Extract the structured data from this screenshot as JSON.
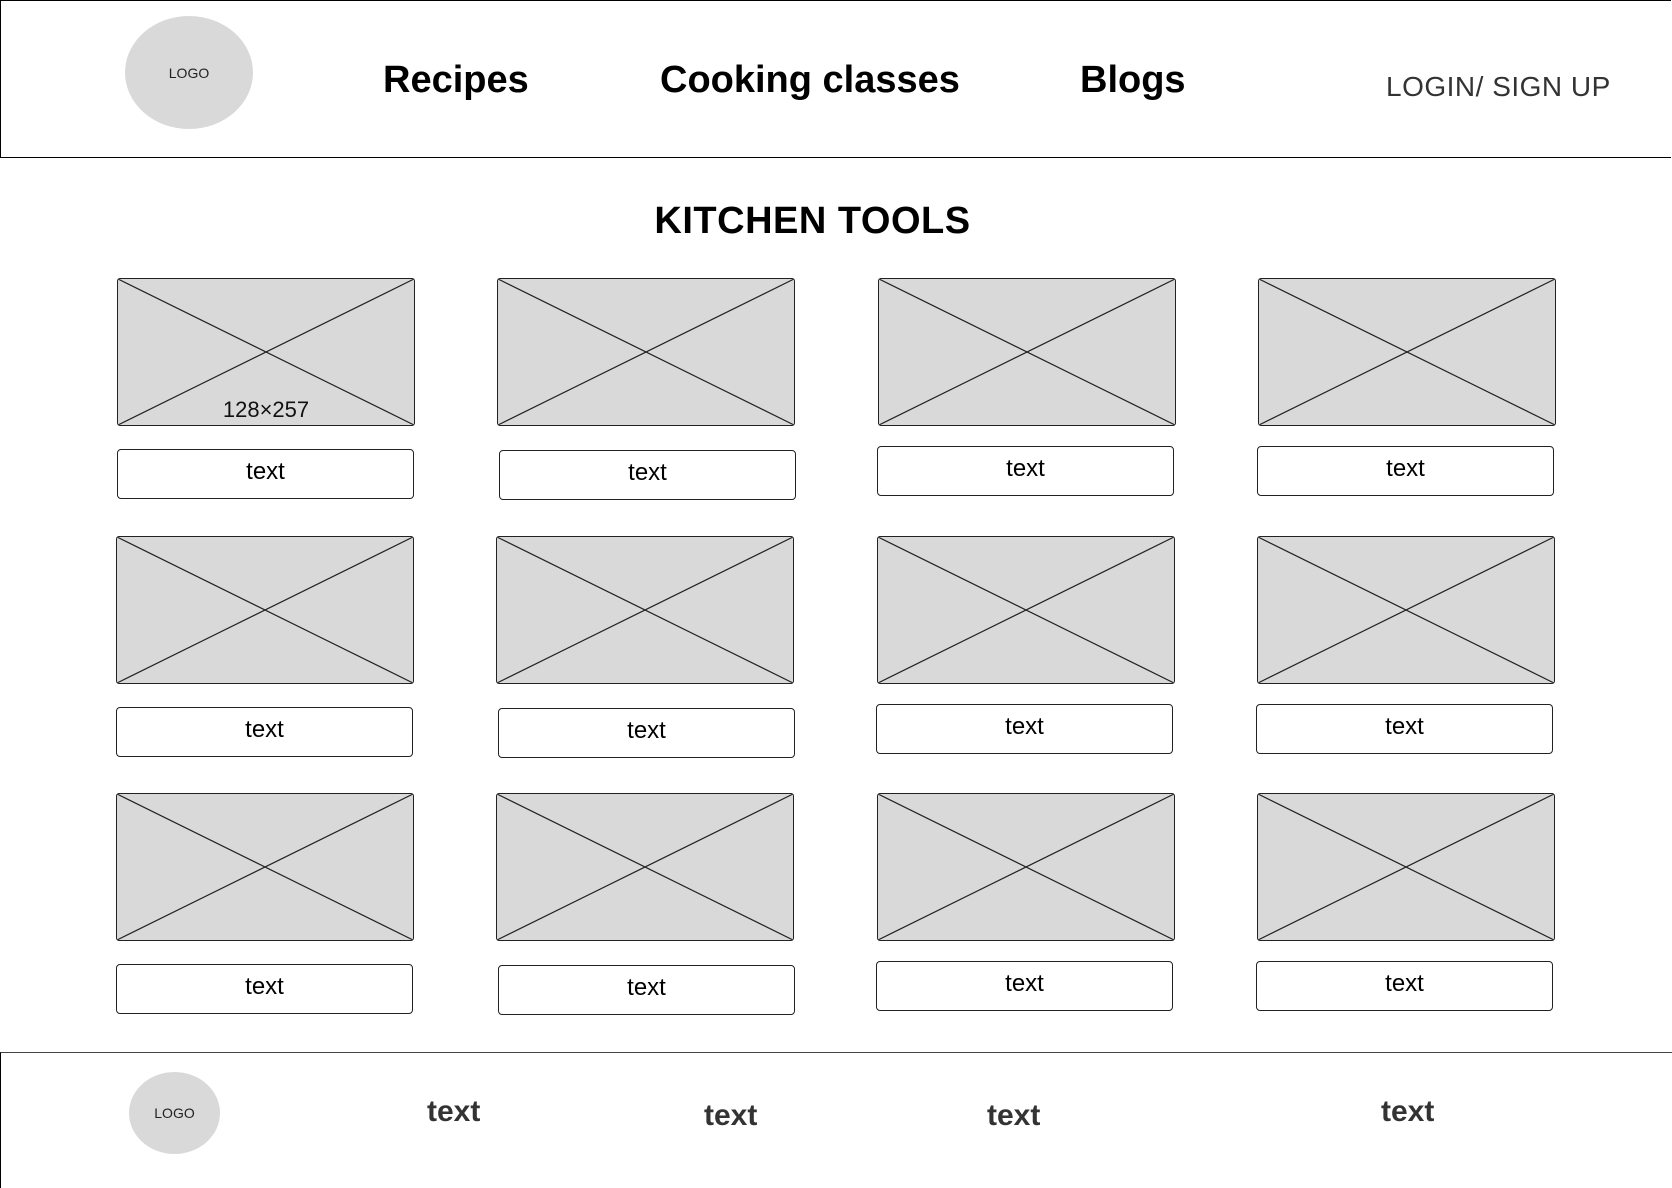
{
  "header": {
    "logo_label": "LOGO",
    "nav": [
      "Recipes",
      "Cooking classes",
      "Blogs"
    ],
    "login_label": "LOGIN/ SIGN UP"
  },
  "main": {
    "title": "KITCHEN TOOLS",
    "first_image_caption": "128×257",
    "cards": [
      {
        "label": "text"
      },
      {
        "label": "text"
      },
      {
        "label": "text"
      },
      {
        "label": "text"
      },
      {
        "label": "text"
      },
      {
        "label": "text"
      },
      {
        "label": "text"
      },
      {
        "label": "text"
      },
      {
        "label": "text"
      },
      {
        "label": "text"
      },
      {
        "label": "text"
      },
      {
        "label": "text"
      }
    ]
  },
  "footer": {
    "logo_label": "LOGO",
    "links": [
      "text",
      "text",
      "text",
      "text"
    ]
  },
  "colors": {
    "placeholder_fill": "#d9d9d9",
    "border": "#222222"
  }
}
